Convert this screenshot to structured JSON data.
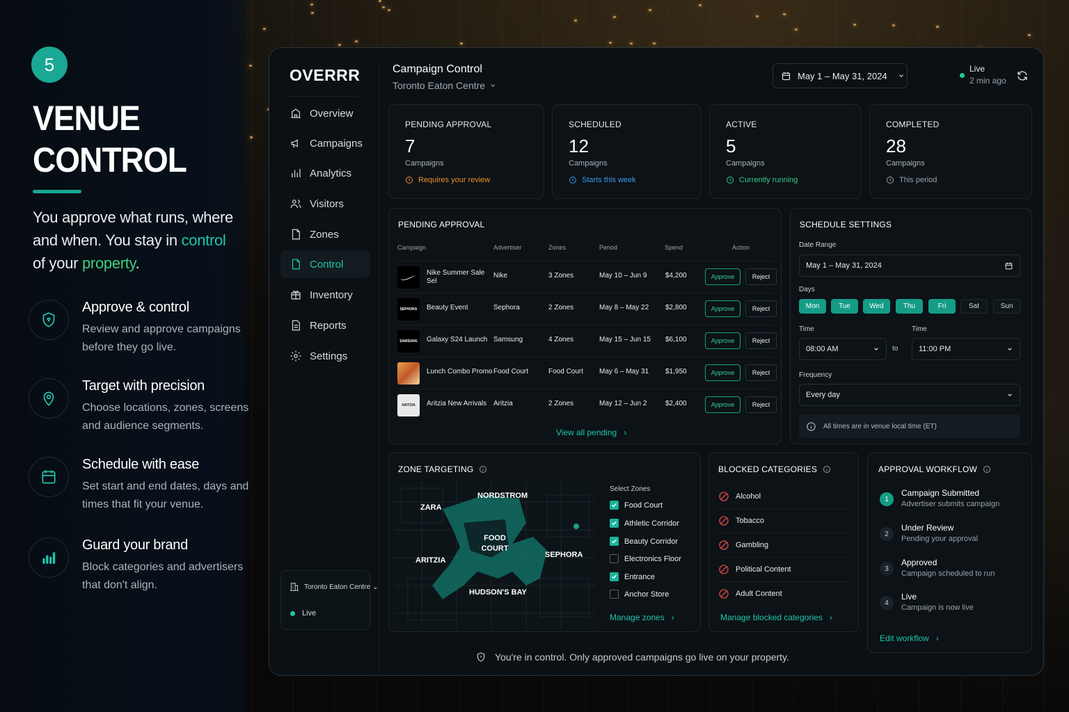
{
  "hero": {
    "step": "5",
    "title_line1": "VENUE",
    "title_line2": "CONTROL",
    "tag_pre": "You approve what runs, where and when. You stay in ",
    "tag_acc1": "control",
    "tag_mid": " of your ",
    "tag_acc2": "property",
    "tag_end": "."
  },
  "features": [
    {
      "icon": "shield-icon",
      "title": "Approve & control",
      "desc": "Review and approve campaigns before they go live."
    },
    {
      "icon": "location-pin-icon",
      "title": "Target with precision",
      "desc": "Choose locations, zones, screens and audience segments."
    },
    {
      "icon": "calendar-icon",
      "title": "Schedule with ease",
      "desc": "Set start and end dates, days and times that fit your venue."
    },
    {
      "icon": "bar-chart-icon",
      "title": "Guard your brand",
      "desc": "Block categories and advertisers that don't align."
    }
  ],
  "app": {
    "logo": "OVERRR",
    "nav": [
      {
        "label": "Overview",
        "icon": "overview-icon"
      },
      {
        "label": "Campaigns",
        "icon": "megaphone-icon"
      },
      {
        "label": "Analytics",
        "icon": "analytics-icon"
      },
      {
        "label": "Visitors",
        "icon": "visitors-icon"
      },
      {
        "label": "Zones",
        "icon": "zones-icon"
      },
      {
        "label": "Control",
        "icon": "control-icon",
        "active": true
      },
      {
        "label": "Inventory",
        "icon": "inventory-icon"
      },
      {
        "label": "Reports",
        "icon": "reports-icon"
      },
      {
        "label": "Settings",
        "icon": "settings-icon"
      }
    ],
    "venue": {
      "name": "Toronto Eaton Centre",
      "status": "Live"
    },
    "header": {
      "title": "Campaign Control",
      "venue": "Toronto Eaton Centre",
      "date_range": "May 1 – May 31, 2024",
      "live": "Live",
      "updated": "2 min ago"
    },
    "stats": [
      {
        "label": "PENDING APPROVAL",
        "value": "7",
        "unit": "Campaigns",
        "note": "Requires your review",
        "color": "#f0902a"
      },
      {
        "label": "SCHEDULED",
        "value": "12",
        "unit": "Campaigns",
        "note": "Starts this week",
        "color": "#3d9bf0"
      },
      {
        "label": "ACTIVE",
        "value": "5",
        "unit": "Campaigns",
        "note": "Currently running",
        "color": "#35c98a"
      },
      {
        "label": "COMPLETED",
        "value": "28",
        "unit": "Campaigns",
        "note": "This period",
        "color": "#9aa4ab"
      }
    ],
    "pending": {
      "title": "PENDING APPROVAL",
      "columns": [
        "Campaign",
        "Advertiser",
        "Zones",
        "Period",
        "Spend",
        "Action"
      ],
      "rows": [
        {
          "campaign": "Nike Summer Sale Sel",
          "advertiser": "Nike",
          "zones": "3 Zones",
          "period": "May 10 – Jun 9",
          "spend": "$4,200",
          "logo": "nike"
        },
        {
          "campaign": "Beauty Event",
          "advertiser": "Sephora",
          "zones": "2 Zones",
          "period": "May 8 – May 22",
          "spend": "$2,800",
          "logo": "SEPHORA"
        },
        {
          "campaign": "Galaxy S24 Launch",
          "advertiser": "Samsung",
          "zones": "4 Zones",
          "period": "May 15 – Jun 15",
          "spend": "$6,100",
          "logo": "SAMSUNG"
        },
        {
          "campaign": "Lunch Combo Promo",
          "advertiser": "Food Court",
          "zones": "Food Court",
          "period": "May 6 – May 31",
          "spend": "$1,950",
          "logo": "food"
        },
        {
          "campaign": "Aritzia New Arrivals",
          "advertiser": "Aritzia",
          "zones": "2 Zones",
          "period": "May 12 – Jun 2",
          "spend": "$2,400",
          "logo": "ARITZIA"
        }
      ],
      "approve": "Approve",
      "reject": "Reject",
      "view_all": "View all pending"
    },
    "schedule": {
      "title": "SCHEDULE SETTINGS",
      "date_label": "Date Range",
      "date_value": "May 1 – May 31, 2024",
      "days_label": "Days",
      "days": [
        {
          "d": "Mon",
          "on": true
        },
        {
          "d": "Tue",
          "on": true
        },
        {
          "d": "Wed",
          "on": true
        },
        {
          "d": "Thu",
          "on": true
        },
        {
          "d": "Fri",
          "on": true
        },
        {
          "d": "Sat",
          "on": false
        },
        {
          "d": "Sun",
          "on": false
        }
      ],
      "time_label": "Time",
      "time_start": "08:00 AM",
      "to": "to",
      "time_end": "11:00 PM",
      "freq_label": "Frequency",
      "freq_value": "Every day",
      "note": "All times are in venue local time (ET)"
    },
    "zones": {
      "title": "ZONE TARGETING",
      "select_label": "Select Zones",
      "map_labels": [
        "ZARA",
        "NORDSTROM",
        "FOOD COURT",
        "ARITZIA",
        "SEPHORA",
        "HUDSON'S BAY"
      ],
      "items": [
        {
          "name": "Food Court",
          "on": true
        },
        {
          "name": "Athletic Corridor",
          "on": true
        },
        {
          "name": "Beauty Corridor",
          "on": true
        },
        {
          "name": "Electronics Floor",
          "on": false
        },
        {
          "name": "Entrance",
          "on": true
        },
        {
          "name": "Anchor Store",
          "on": false
        }
      ],
      "manage": "Manage zones"
    },
    "blocked": {
      "title": "BLOCKED CATEGORIES",
      "items": [
        "Alcohol",
        "Tobacco",
        "Gambling",
        "Political Content",
        "Adult Content"
      ],
      "manage": "Manage blocked categories"
    },
    "workflow": {
      "title": "APPROVAL WORKFLOW",
      "steps": [
        {
          "n": "1",
          "t": "Campaign Submitted",
          "d": "Advertiser submits campaign",
          "on": true
        },
        {
          "n": "2",
          "t": "Under Review",
          "d": "Pending your approval",
          "on": false
        },
        {
          "n": "3",
          "t": "Approved",
          "d": "Campaign scheduled to run",
          "on": false
        },
        {
          "n": "4",
          "t": "Live",
          "d": "Campaign is now live",
          "on": false
        }
      ],
      "edit": "Edit workflow"
    },
    "footer": "You're in control. Only approved campaigns go live on your property."
  },
  "colors": {
    "accent": "#21c5ac",
    "card": "#0c1216",
    "border": "#1e272d"
  }
}
